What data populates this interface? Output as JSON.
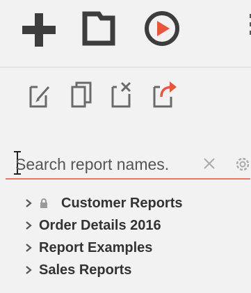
{
  "toolbar": {
    "buttons": [
      {
        "name": "add",
        "icon": "plus-icon"
      },
      {
        "name": "new-folder",
        "icon": "folder-icon"
      },
      {
        "name": "run",
        "icon": "play-circle-icon"
      }
    ],
    "secondary_buttons": [
      {
        "name": "edit",
        "icon": "edit-icon"
      },
      {
        "name": "copy",
        "icon": "copy-icon"
      },
      {
        "name": "delete",
        "icon": "delete-icon"
      },
      {
        "name": "export",
        "icon": "share-icon"
      }
    ]
  },
  "search": {
    "placeholder": "Search report names.",
    "value": ""
  },
  "tree": {
    "items": [
      {
        "label": "Customer Reports",
        "locked": true
      },
      {
        "label": "Order Details 2016",
        "locked": false
      },
      {
        "label": "Report Examples",
        "locked": false
      },
      {
        "label": "Sales Reports",
        "locked": false
      }
    ]
  },
  "colors": {
    "accent": "#e8755a",
    "icon_dark": "#3d3d3d",
    "icon_light": "#6a6a6a",
    "play": "#e8563e",
    "background": "#f2f2f2"
  }
}
